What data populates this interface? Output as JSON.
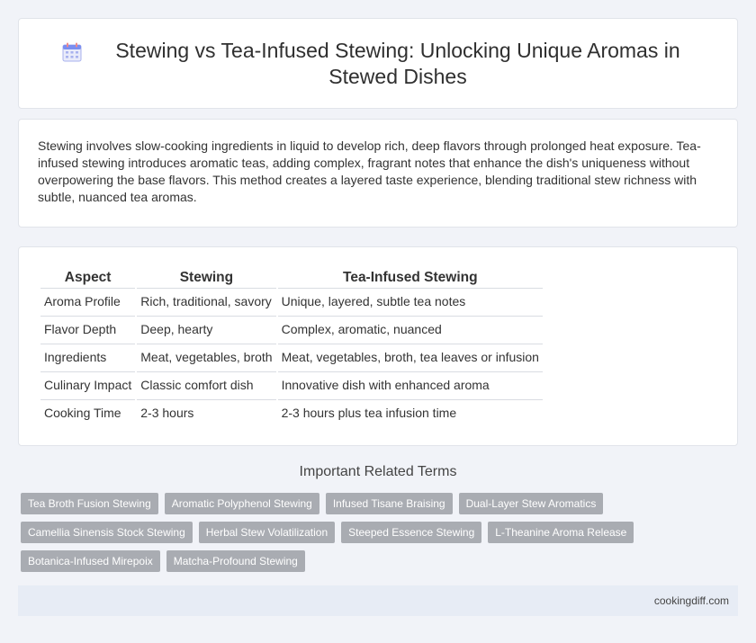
{
  "header": {
    "title": "Stewing vs Tea-Infused Stewing: Unlocking Unique Aromas in Stewed Dishes",
    "icon": "calendar-icon"
  },
  "intro": {
    "text": "Stewing involves slow-cooking ingredients in liquid to develop rich, deep flavors through prolonged heat exposure. Tea-infused stewing introduces aromatic teas, adding complex, fragrant notes that enhance the dish's uniqueness without overpowering the base flavors. This method creates a layered taste experience, blending traditional stew richness with subtle, nuanced tea aromas."
  },
  "table": {
    "headers": [
      "Aspect",
      "Stewing",
      "Tea-Infused Stewing"
    ],
    "rows": [
      [
        "Aroma Profile",
        "Rich, traditional, savory",
        "Unique, layered, subtle tea notes"
      ],
      [
        "Flavor Depth",
        "Deep, hearty",
        "Complex, aromatic, nuanced"
      ],
      [
        "Ingredients",
        "Meat, vegetables, broth",
        "Meat, vegetables, broth, tea leaves or infusion"
      ],
      [
        "Culinary Impact",
        "Classic comfort dish",
        "Innovative dish with enhanced aroma"
      ],
      [
        "Cooking Time",
        "2-3 hours",
        "2-3 hours plus tea infusion time"
      ]
    ]
  },
  "related": {
    "title": "Important Related Terms",
    "tags": [
      "Tea Broth Fusion Stewing",
      "Aromatic Polyphenol Stewing",
      "Infused Tisane Braising",
      "Dual-Layer Stew Aromatics",
      "Camellia Sinensis Stock Stewing",
      "Herbal Stew Volatilization",
      "Steeped Essence Stewing",
      "L-Theanine Aroma Release",
      "Botanica-Infused Mirepoix",
      "Matcha-Profound Stewing"
    ]
  },
  "footer": {
    "site": "cookingdiff.com"
  }
}
